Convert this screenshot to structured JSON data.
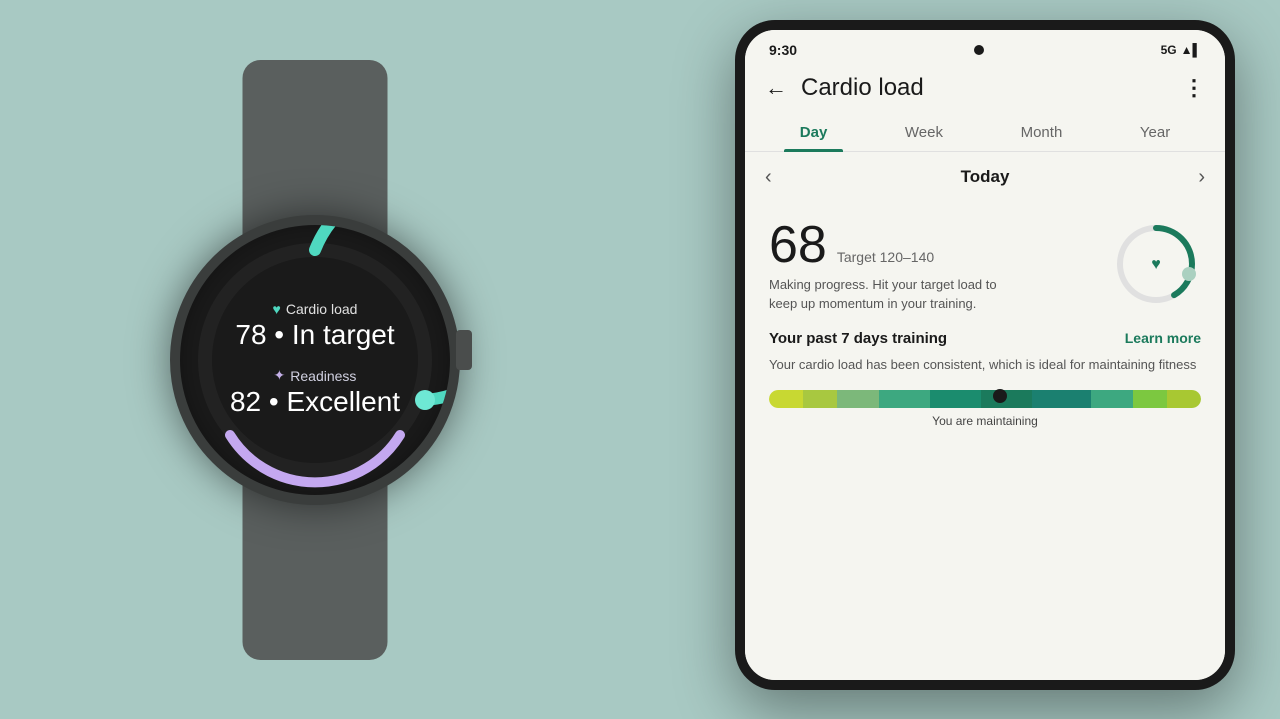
{
  "background_color": "#a8c9c3",
  "watch": {
    "cardio_icon": "♥",
    "cardio_label": "Cardio load",
    "cardio_value": "78 • In target",
    "readiness_icon": "✦",
    "readiness_label": "Readiness",
    "readiness_value": "82 • Excellent"
  },
  "phone": {
    "status": {
      "time": "9:30",
      "signal": "5G",
      "icons": "5G ▲▌"
    },
    "header": {
      "title": "Cardio load",
      "back_label": "←",
      "more_label": "⋮"
    },
    "tabs": [
      {
        "label": "Day",
        "active": true
      },
      {
        "label": "Week",
        "active": false
      },
      {
        "label": "Month",
        "active": false
      },
      {
        "label": "Year",
        "active": false
      }
    ],
    "date_nav": {
      "prev": "‹",
      "label": "Today",
      "next": "›"
    },
    "metric": {
      "value": "68",
      "target_label": "Target 120–140",
      "description": "Making progress. Hit your target load to keep up momentum in your training."
    },
    "past7": {
      "section_title": "Your past 7 days training",
      "learn_more": "Learn more",
      "description": "Your cardio load has been consistent, which is ideal for maintaining fitness",
      "bar_label": "You are maintaining",
      "segments": [
        {
          "color": "#b8c832",
          "width": 12
        },
        {
          "color": "#7cb87a",
          "width": 10
        },
        {
          "color": "#1b8c6e",
          "width": 20
        },
        {
          "color": "#1b7a5c",
          "width": 18
        },
        {
          "color": "#1b7a5c",
          "width": 16
        },
        {
          "color": "#8fbe44",
          "width": 12
        },
        {
          "color": "#c8d840",
          "width": 12
        }
      ],
      "indicator_position_pct": 53
    }
  }
}
